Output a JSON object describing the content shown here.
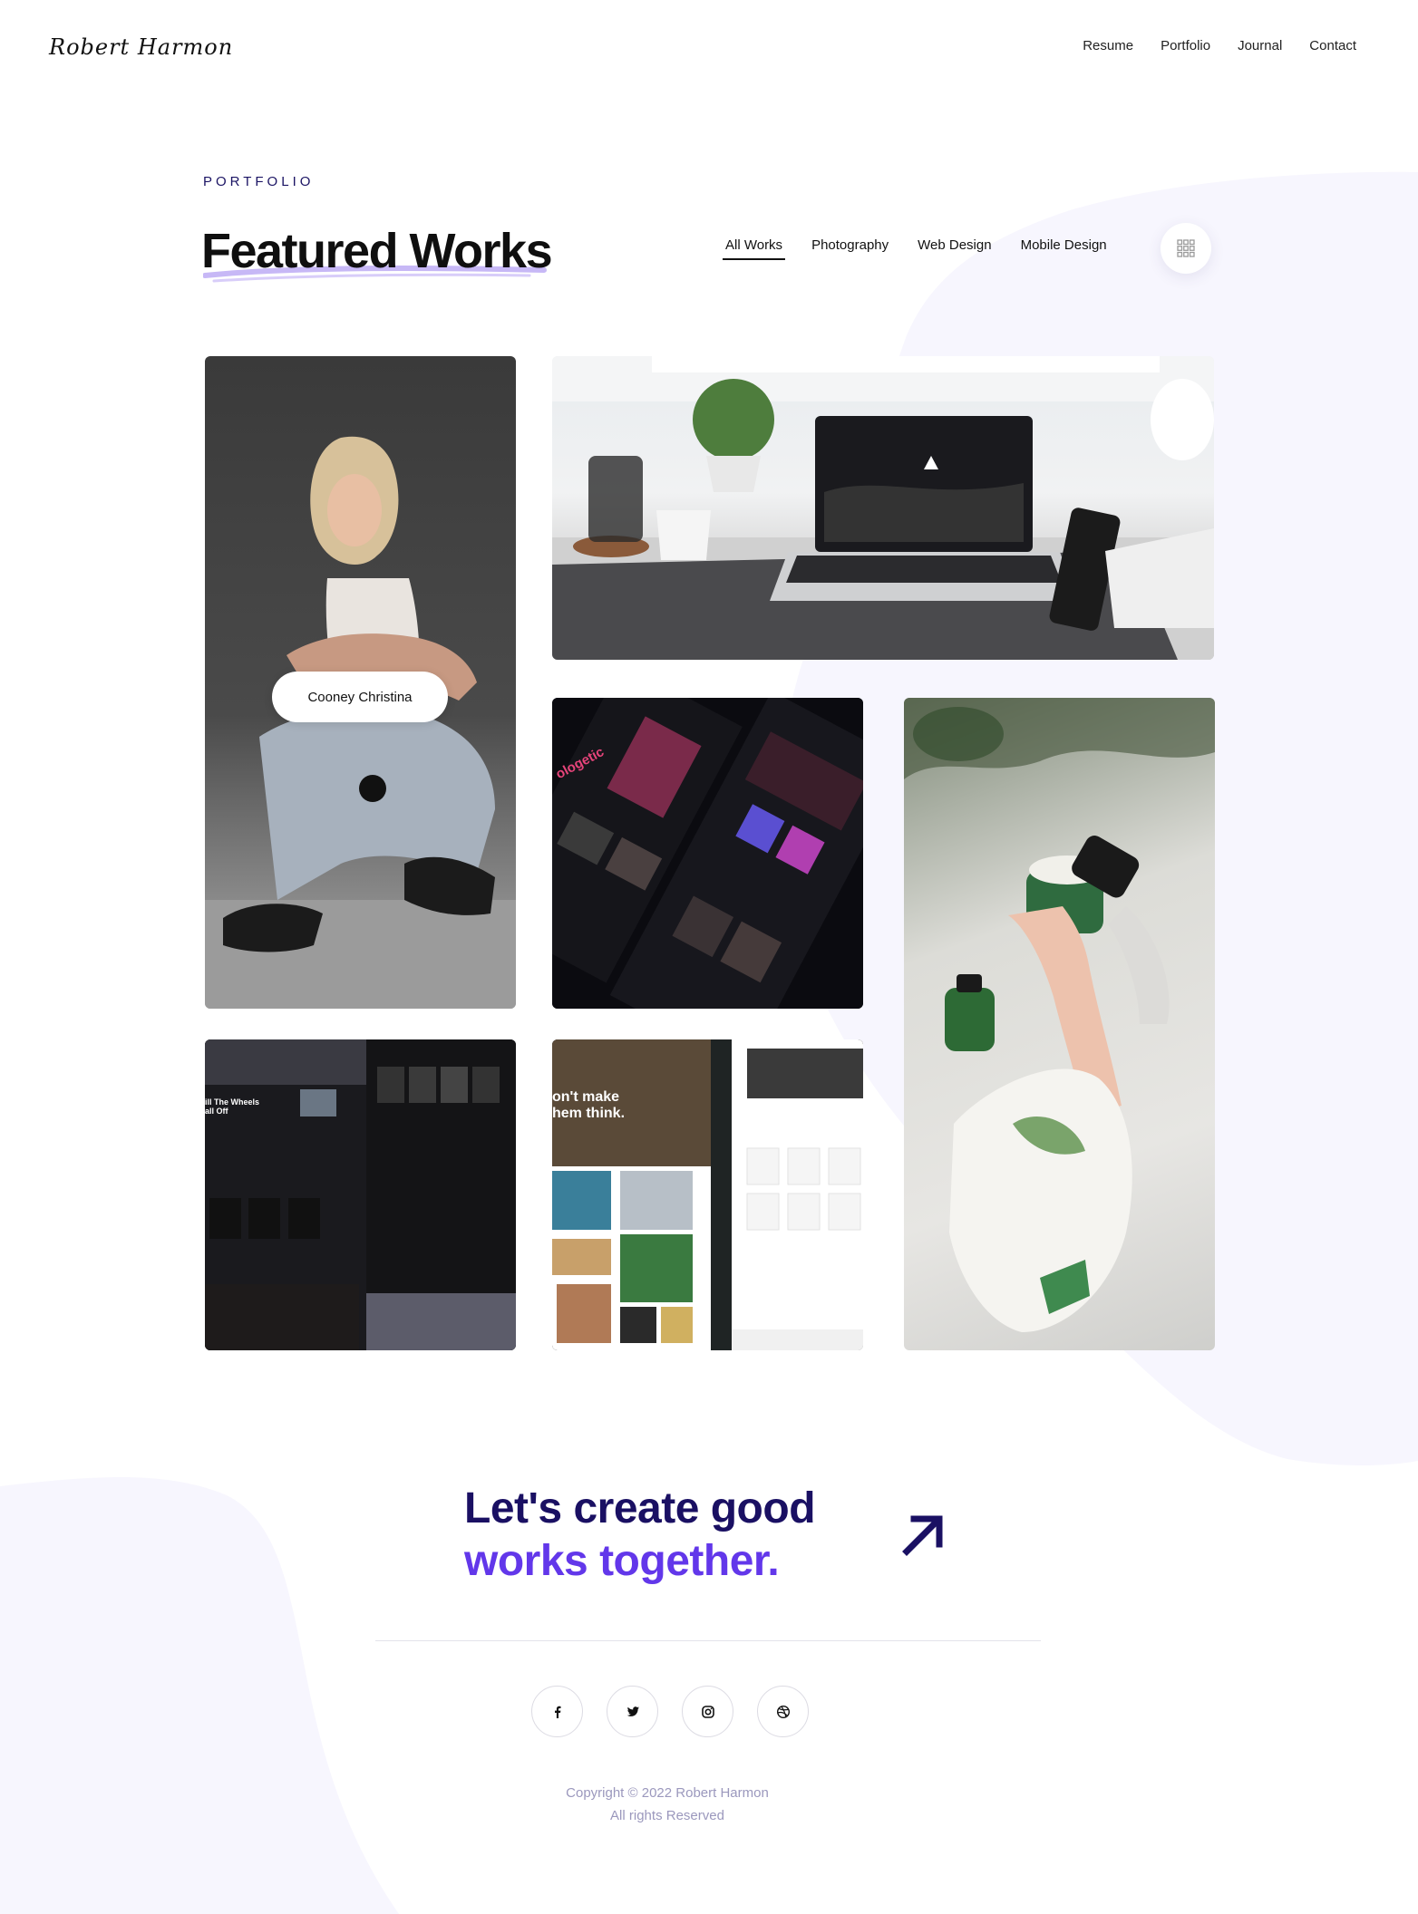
{
  "header": {
    "logo": "Robert Harmon",
    "nav": [
      "Resume",
      "Portfolio",
      "Journal",
      "Contact"
    ]
  },
  "section": {
    "eyebrow": "PORTFOLIO",
    "title": "Featured Works",
    "filters": [
      "All Works",
      "Photography",
      "Web Design",
      "Mobile Design"
    ],
    "active_filter": "All Works"
  },
  "tiles": {
    "hover_label": "Cooney Christina"
  },
  "cta": {
    "line1": "Let's create good",
    "line2": "works together."
  },
  "footer": {
    "socials": [
      "facebook-icon",
      "twitter-icon",
      "instagram-icon",
      "dribbble-icon"
    ],
    "copyright": "Copyright © 2022 Robert Harmon",
    "rights": "All rights Reserved"
  },
  "colors": {
    "navy": "#1a1063",
    "accent": "#6237ea",
    "blob": "#f7f6fe"
  }
}
